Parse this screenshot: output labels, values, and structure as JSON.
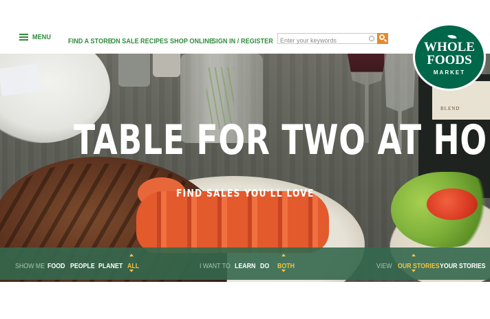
{
  "header": {
    "menu_label": "MENU",
    "nav": [
      "FIND A STORE",
      "ON SALE",
      "RECIPES",
      "SHOP ONLINE",
      "SIGN IN / REGISTER"
    ],
    "search": {
      "placeholder": "Enter your keywords",
      "value": ""
    }
  },
  "logo": {
    "line1": "WHOLE",
    "line2": "FOODS",
    "line3": "MARKET"
  },
  "hero": {
    "headline": "TABLE FOR TWO AT HOME",
    "subhead": "FIND SALES YOU'LL LOVE",
    "bottle_label": "BLEND"
  },
  "filter_bar": {
    "show_me": {
      "label": "SHOW ME",
      "options": [
        "FOOD",
        "PEOPLE",
        "PLANET",
        "ALL"
      ],
      "selected": "ALL"
    },
    "i_want_to": {
      "label": "I WANT TO",
      "options": [
        "LEARN",
        "DO",
        "BOTH"
      ],
      "selected": "BOTH"
    },
    "view": {
      "label": "VIEW",
      "options": [
        "OUR STORIES",
        "YOUR STORIES"
      ],
      "selected": "OUR STORIES"
    }
  },
  "colors": {
    "brand_green": "#00674a",
    "nav_green": "#2f8a3c",
    "search_button_orange": "#e58a2c",
    "filter_bar": "#34684e",
    "active_yellow": "#f4c43d"
  },
  "icons": [
    "hamburger-icon",
    "search-icon",
    "clear-icon",
    "caret-up-icon",
    "caret-down-icon",
    "leaf-icon"
  ]
}
